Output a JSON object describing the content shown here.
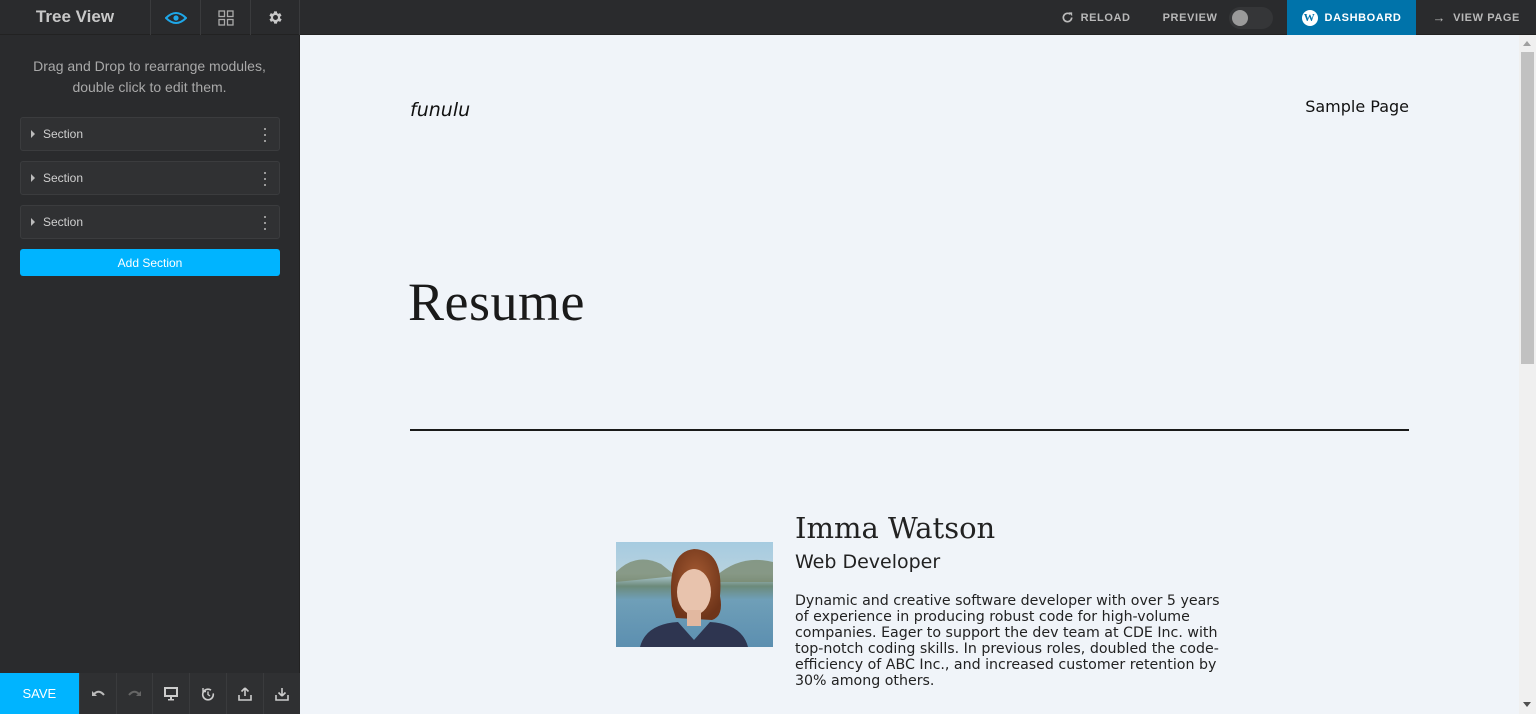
{
  "topbar": {
    "title": "Tree View",
    "tabs": [
      {
        "name": "eye-icon",
        "active": true
      },
      {
        "name": "grid-icon",
        "active": false
      },
      {
        "name": "gear-icon",
        "active": false
      }
    ],
    "reload_label": "RELOAD",
    "preview_label": "PREVIEW",
    "preview_on": false,
    "dashboard_label": "DASHBOARD",
    "view_page_label": "VIEW PAGE",
    "accent_color": "#00b4ff",
    "dashboard_color": "#0073aa"
  },
  "sidebar": {
    "hint": "Drag and Drop to rearrange modules, double click to edit them.",
    "sections": [
      {
        "label": "Section"
      },
      {
        "label": "Section"
      },
      {
        "label": "Section"
      }
    ],
    "add_section_label": "Add Section"
  },
  "bottombar": {
    "save_label": "SAVE",
    "icons": [
      "undo-icon",
      "redo-icon",
      "desktop-icon",
      "history-icon",
      "upload-icon",
      "download-icon"
    ]
  },
  "page": {
    "site_title": "funulu",
    "nav_link": "Sample Page",
    "title": "Resume",
    "profile": {
      "name": "Imma Watson",
      "role": "Web Developer",
      "bio": "Dynamic and creative software developer with over 5 years of experience in producing robust code for high-volume companies. Eager to support the dev team at CDE Inc. with top-notch coding skills. In previous roles, doubled the code-efficiency of ABC Inc., and increased customer retention by 30% among others."
    }
  }
}
